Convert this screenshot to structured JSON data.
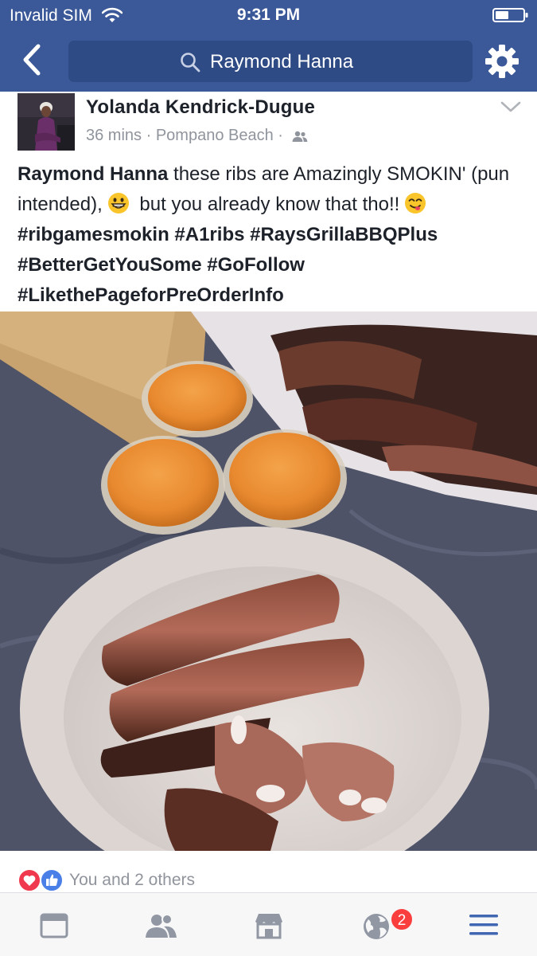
{
  "status_bar": {
    "carrier": "Invalid SIM",
    "time": "9:31 PM",
    "wifi_icon": "wifi-icon",
    "battery_icon": "battery-icon"
  },
  "nav": {
    "back_icon": "chevron-left-icon",
    "search_value": "Raymond Hanna",
    "search_icon": "search-icon",
    "settings_icon": "gear-icon"
  },
  "post": {
    "author": "Yolanda Kendrick-Dugue",
    "time": "36 mins",
    "location": "Pompano Beach",
    "separator": "·",
    "audience_icon": "friends-icon",
    "menu_icon": "chevron-down-icon",
    "text": {
      "mention": "Raymond Hanna",
      "part1": " these ribs are Amazingly SMOKIN' (pun intended),",
      "part2": " but you already know that tho!!",
      "hashtags": [
        "#ribgamesmokin",
        "#A1ribs",
        "#RaysGrillaBBQPlus",
        "#BetterGetYouSome",
        "#GoFollow",
        "#LikethePageforPreOrderInfo"
      ]
    },
    "photo_alt": "Smoked ribs on a white plate with three cups of orange sauce"
  },
  "reactions": {
    "icons": [
      "heart-icon",
      "thumbs-up-icon"
    ],
    "summary": "You and 2 others"
  },
  "tab_bar": {
    "tabs": [
      "news-feed-icon",
      "friends-icon",
      "marketplace-icon",
      "notifications-globe-icon",
      "menu-icon"
    ],
    "notification_count": "2"
  },
  "colors": {
    "brand": "#3b5998",
    "tab_active": "#4267b2",
    "badge": "#fa3e3e"
  }
}
